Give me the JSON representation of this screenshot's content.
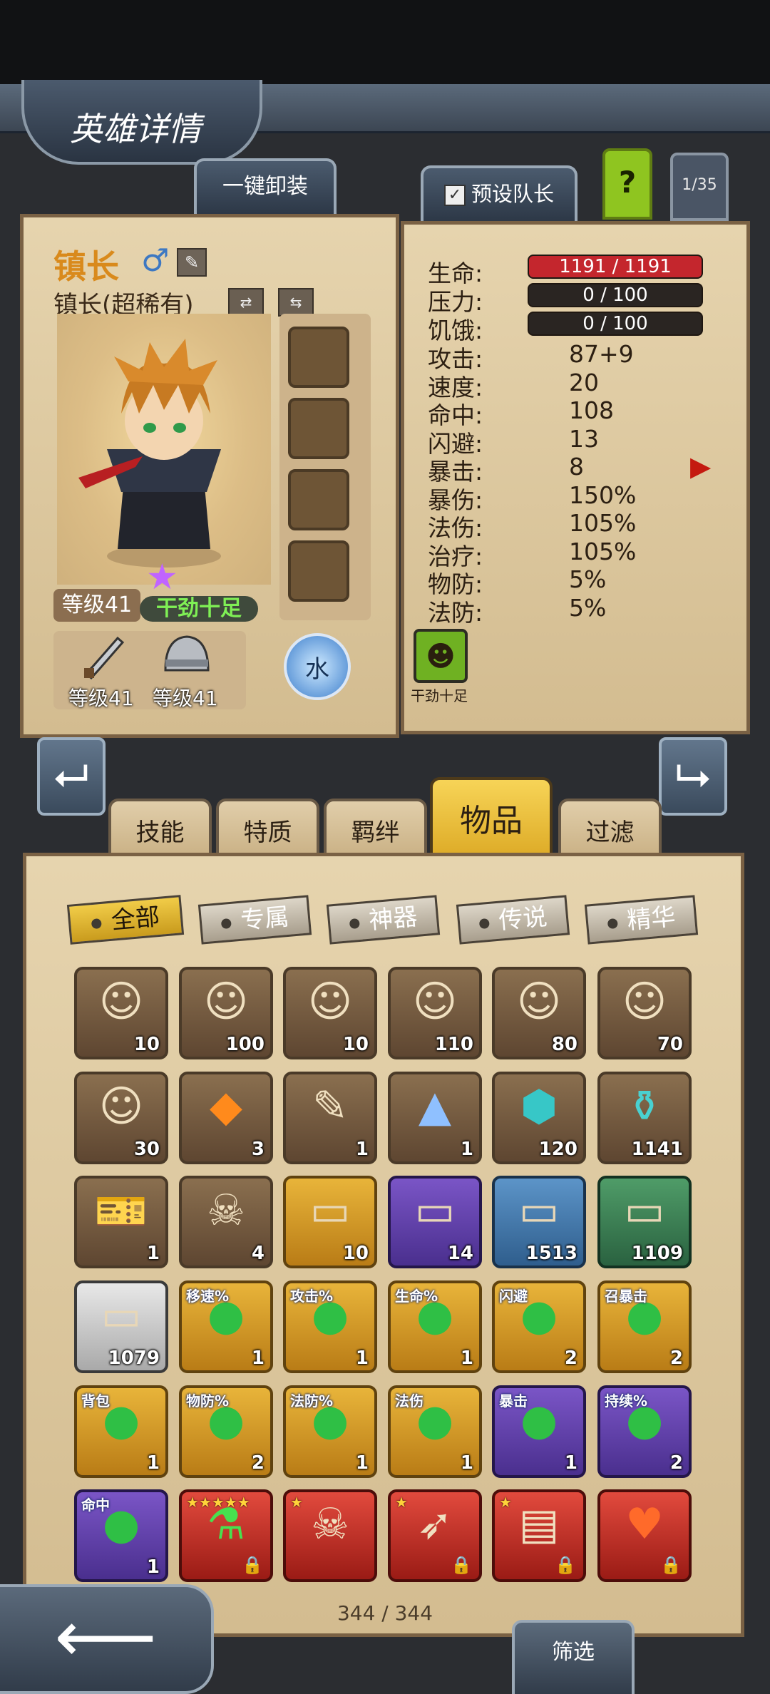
{
  "header": {
    "title": "英雄详情",
    "unequip_all": "一键卸装",
    "preset_leader": "预设队长",
    "help": "?",
    "page_counter": "1/35"
  },
  "hero": {
    "name": "镇长",
    "class_label": "镇长(超稀有)",
    "level": "等级41",
    "trait": "干劲十足",
    "weapon_level": "等级41",
    "armor_level": "等级41",
    "element": "水",
    "icons": {
      "gender": "male-icon",
      "edit": "pencil-icon"
    }
  },
  "stats": {
    "hp": {
      "label": "生命:",
      "value": "1191 / 1191",
      "fraction": 1.0,
      "color": "#c4262d"
    },
    "stress": {
      "label": "压力:",
      "value": "0 / 100",
      "fraction": 0.0
    },
    "hunger": {
      "label": "饥饿:",
      "value": "0 / 100",
      "fraction": 0.0
    },
    "rows": [
      {
        "label": "攻击:",
        "value": "87+9"
      },
      {
        "label": "速度:",
        "value": "20"
      },
      {
        "label": "命中:",
        "value": "108"
      },
      {
        "label": "闪避:",
        "value": "13"
      },
      {
        "label": "暴击:",
        "value": "8"
      },
      {
        "label": "暴伤:",
        "value": "150%"
      },
      {
        "label": "法伤:",
        "value": "105%"
      },
      {
        "label": "治疗:",
        "value": "105%"
      },
      {
        "label": "物防:",
        "value": "5%"
      },
      {
        "label": "法防:",
        "value": "5%"
      }
    ],
    "trait_caption": "干劲十足"
  },
  "tabs": [
    "技能",
    "特质",
    "羁绊",
    "物品",
    "过滤"
  ],
  "filters": [
    "全部",
    "专属",
    "神器",
    "传说",
    "精华"
  ],
  "items": [
    {
      "kind": "hero",
      "count": "10",
      "bg": "brown",
      "icon": "hero-portrait-icon"
    },
    {
      "kind": "hero",
      "count": "100",
      "bg": "brown",
      "icon": "hero-portrait-icon"
    },
    {
      "kind": "hero",
      "count": "10",
      "bg": "brown",
      "icon": "hero-portrait-icon"
    },
    {
      "kind": "hero",
      "count": "110",
      "bg": "brown",
      "icon": "hero-portrait-icon"
    },
    {
      "kind": "hero",
      "count": "80",
      "bg": "brown",
      "icon": "hero-portrait-icon"
    },
    {
      "kind": "hero",
      "count": "70",
      "bg": "brown",
      "icon": "hero-portrait-icon"
    },
    {
      "kind": "hero",
      "count": "30",
      "bg": "brown",
      "icon": "hero-portrait-icon"
    },
    {
      "kind": "gem",
      "count": "3",
      "bg": "brown",
      "icon": "orange-gem-icon"
    },
    {
      "kind": "tool",
      "count": "1",
      "bg": "brown",
      "icon": "chisel-icon"
    },
    {
      "kind": "material",
      "count": "1",
      "bg": "brown",
      "icon": "crystal-pile-icon"
    },
    {
      "kind": "rune",
      "count": "120",
      "bg": "brown",
      "icon": "rune-stone-icon"
    },
    {
      "kind": "potion",
      "count": "1141",
      "bg": "brown",
      "icon": "potion-icon"
    },
    {
      "kind": "ticket",
      "count": "1",
      "bg": "brown",
      "icon": "ticket-icon"
    },
    {
      "kind": "doll",
      "count": "4",
      "bg": "brown",
      "icon": "skull-doll-icon"
    },
    {
      "kind": "chest",
      "count": "10",
      "bg": "gold",
      "icon": "chest-icon"
    },
    {
      "kind": "chest",
      "count": "14",
      "bg": "purple",
      "icon": "chest-icon"
    },
    {
      "kind": "chest",
      "count": "1513",
      "bg": "blue",
      "icon": "chest-icon"
    },
    {
      "kind": "chest",
      "count": "1109",
      "bg": "green",
      "icon": "chest-icon"
    },
    {
      "kind": "chest",
      "count": "1079",
      "bg": "white",
      "icon": "chest-icon"
    },
    {
      "kind": "essence",
      "tag": "移速%",
      "count": "1",
      "bg": "gold",
      "icon": "green-orb-icon"
    },
    {
      "kind": "essence",
      "tag": "攻击%",
      "count": "1",
      "bg": "gold",
      "icon": "green-orb-icon"
    },
    {
      "kind": "essence",
      "tag": "生命%",
      "count": "1",
      "bg": "gold",
      "icon": "green-orb-icon"
    },
    {
      "kind": "essence",
      "tag": "闪避",
      "count": "2",
      "bg": "gold",
      "icon": "green-orb-icon"
    },
    {
      "kind": "essence",
      "tag": "召暴击",
      "count": "2",
      "bg": "gold",
      "icon": "green-orb-icon"
    },
    {
      "kind": "essence",
      "tag": "背包",
      "count": "1",
      "bg": "gold",
      "icon": "green-orb-icon"
    },
    {
      "kind": "essence",
      "tag": "物防%",
      "count": "2",
      "bg": "gold",
      "icon": "green-orb-icon"
    },
    {
      "kind": "essence",
      "tag": "法防%",
      "count": "1",
      "bg": "gold",
      "icon": "green-orb-icon"
    },
    {
      "kind": "essence",
      "tag": "法伤",
      "count": "1",
      "bg": "gold",
      "icon": "green-orb-icon"
    },
    {
      "kind": "essence",
      "tag": "暴击",
      "count": "1",
      "bg": "purple",
      "icon": "green-orb-icon"
    },
    {
      "kind": "essence",
      "tag": "持续%",
      "count": "2",
      "bg": "purple",
      "icon": "green-orb-icon"
    },
    {
      "kind": "essence",
      "tag": "命中",
      "count": "1",
      "bg": "purple",
      "icon": "green-orb-icon"
    },
    {
      "kind": "relic",
      "stars": "★★★★★",
      "bg": "red",
      "locked": true,
      "icon": "green-flask-icon"
    },
    {
      "kind": "relic",
      "stars": "★",
      "bg": "red",
      "locked": false,
      "icon": "skull-cape-icon"
    },
    {
      "kind": "relic",
      "stars": "★",
      "bg": "red",
      "locked": true,
      "icon": "rifle-icon"
    },
    {
      "kind": "relic",
      "stars": "★",
      "bg": "red",
      "locked": true,
      "icon": "spellbook-icon"
    },
    {
      "kind": "relic",
      "stars": "",
      "bg": "red",
      "locked": true,
      "icon": "fire-heart-icon"
    }
  ],
  "footer": {
    "inventory_count": "344 / 344",
    "screen_button": "筛选",
    "back_icon": "back-arrow-icon"
  }
}
